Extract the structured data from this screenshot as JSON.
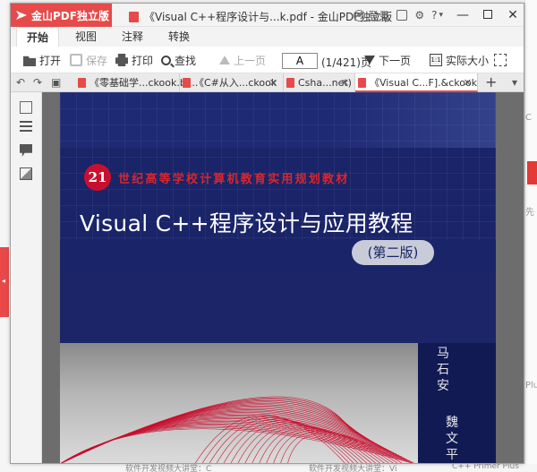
{
  "app": {
    "name": "金山PDF独立版",
    "window_title": "《Visual C++程序设计与...k.pdf - 金山PDF独立版",
    "login_label": "登录",
    "help_label": "?",
    "help_caret": "▾",
    "minimize": "—",
    "close": "✕"
  },
  "ribbon": {
    "tabs": [
      {
        "label": "开始",
        "active": true
      },
      {
        "label": "视图",
        "active": false
      },
      {
        "label": "注释",
        "active": false
      },
      {
        "label": "转换",
        "active": false
      }
    ]
  },
  "toolbar": {
    "open": "打开",
    "save": "保存",
    "print": "打印",
    "find": "查找",
    "prev_page": "上一页",
    "page_input": "A",
    "page_count": "(1/421)页",
    "next_page": "下一页",
    "actual_size": "实际大小",
    "actual_icon_text": "1:1"
  },
  "doc_tabs": [
    {
      "label": "《零基础学...ckook.bi...",
      "active": false
    },
    {
      "label": "《C#从入...ckook",
      "active": false
    },
    {
      "label": "Csha...net)",
      "active": false
    },
    {
      "label": "《Visual C...F].&ckook",
      "active": true
    }
  ],
  "book_cover": {
    "badge": "21",
    "series": "世纪高等学校计算机教育实用规划教材",
    "title": "Visual C++程序设计与应用教程",
    "edition": "(第二版)",
    "author1": "马石安",
    "author2": "魏文平"
  },
  "background": {
    "right_text_1": "C",
    "right_text_2": "先",
    "right_text_3": "Plus",
    "bottom_text_1": "软件开发视频大讲堂：C",
    "bottom_text_2": "软件开发视频大讲堂：Vi",
    "bottom_text_3": "C++ Primer Plus"
  },
  "colors": {
    "brand_red": "#e64a4a",
    "cover_blue": "#1a2468",
    "cover_red": "#d8262f"
  }
}
